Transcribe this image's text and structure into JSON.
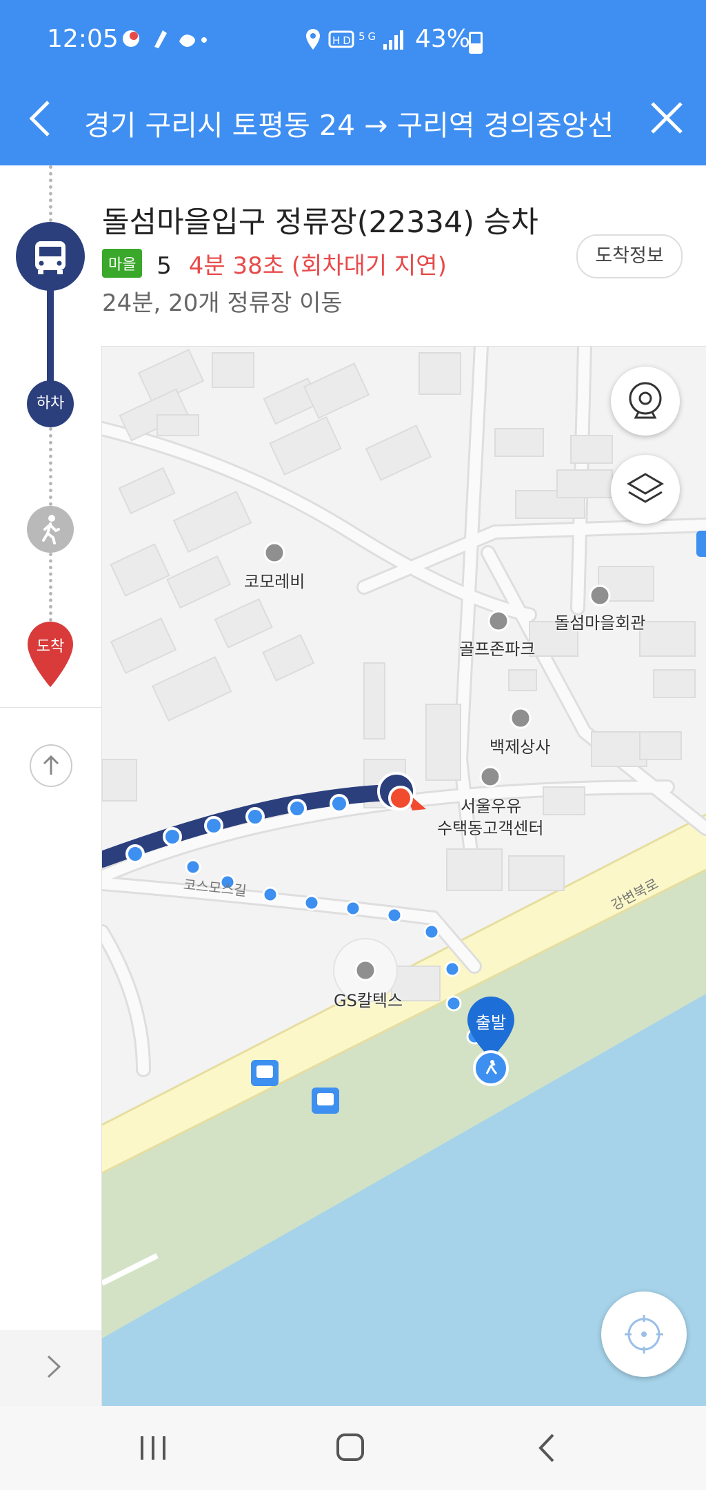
{
  "status_bar": {
    "time": "12:05",
    "network": "5G",
    "hd": "HD",
    "battery": "43%"
  },
  "header": {
    "route_title": "경기 구리시 토평동 24 → 구리역 경의중앙선"
  },
  "panel": {
    "stop_title": "돌섬마을입구 정류장(22334) 승차",
    "bus_type_badge": "마을",
    "bus_number": "5",
    "eta": "4분 38초 (회차대기 지연)",
    "summary": "24분, 20개 정류장 이동",
    "arrival_info_button": "도착정보"
  },
  "timeline": {
    "alight_label": "하차",
    "arrive_label": "도착"
  },
  "map": {
    "pois": [
      {
        "name": "코모레비"
      },
      {
        "name": "골프존파크"
      },
      {
        "name": "돌섬마을회관"
      },
      {
        "name": "백제상사"
      },
      {
        "name": "서울우유"
      },
      {
        "name": "수택동고객센터"
      },
      {
        "name": "GS칼텍스"
      }
    ],
    "roads": [
      "코스모스길",
      "강변북로"
    ],
    "start_label": "출발",
    "colors": {
      "route_bus": "#2b3f7d",
      "route_walk": "#3d8ff0",
      "water": "#a6d3ea",
      "park": "#d3e2c5",
      "highway": "#fbf7c8",
      "current_location": "#f04a2f"
    }
  }
}
